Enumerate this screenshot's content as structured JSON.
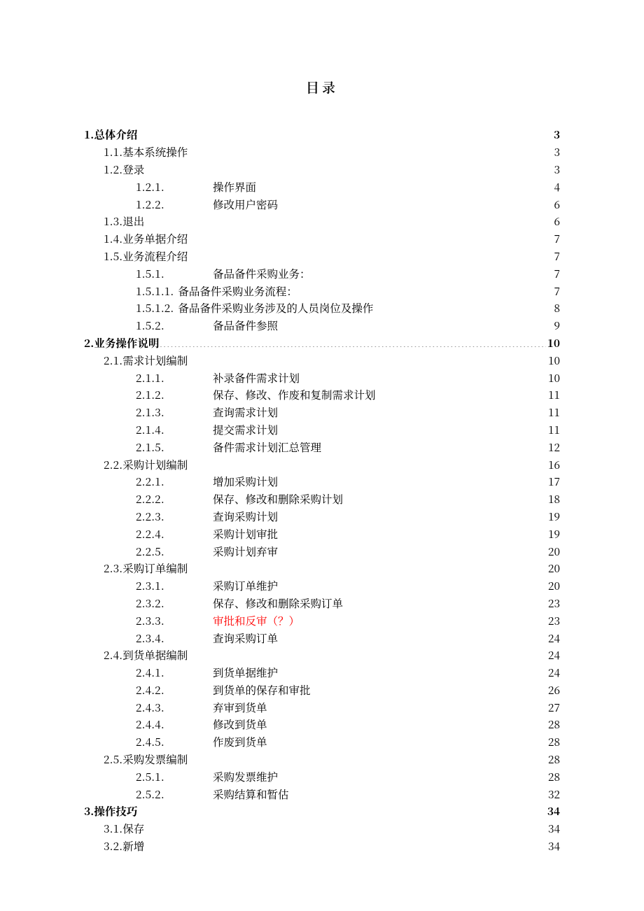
{
  "title": "目录",
  "toc": [
    {
      "level": 1,
      "num": "1.",
      "text": "总体介绍",
      "page": "3",
      "bold": true,
      "color": "",
      "leader": "bold"
    },
    {
      "level": 2,
      "num": "1.1.",
      "text": "基本系统操作",
      "page": "3",
      "bold": false,
      "color": "",
      "leader": "thin"
    },
    {
      "level": 2,
      "num": "1.2.",
      "text": "登录",
      "page": "3",
      "bold": false,
      "color": "",
      "leader": "thin"
    },
    {
      "level": 3,
      "num": "1.2.1.",
      "text": "操作界面",
      "page": "4",
      "bold": false,
      "color": "",
      "leader": "cjk"
    },
    {
      "level": 3,
      "num": "1.2.2.",
      "text": "修改用户密码",
      "page": "6",
      "bold": false,
      "color": "",
      "leader": "cjk"
    },
    {
      "level": 2,
      "num": "1.3.",
      "text": "退出",
      "page": "6",
      "bold": false,
      "color": "",
      "leader": "thin"
    },
    {
      "level": 2,
      "num": "1.4.",
      "text": "业务单据介绍",
      "page": "7",
      "bold": false,
      "color": "",
      "leader": "thin"
    },
    {
      "level": 2,
      "num": "1.5.",
      "text": "业务流程介绍",
      "page": "7",
      "bold": false,
      "color": "",
      "leader": "thin"
    },
    {
      "level": 3,
      "num": "1.5.1.",
      "text": "备品备件采购业务：",
      "page": "7",
      "bold": false,
      "color": "",
      "leader": "cjk"
    },
    {
      "level": 3,
      "num": "1.5.1.1.",
      "text": "备品备件采购业务流程：",
      "page": "7",
      "bold": false,
      "color": "",
      "leader": "cjk",
      "tight": true
    },
    {
      "level": 3,
      "num": "1.5.1.2.",
      "text": "备品备件采购业务涉及的人员岗位及操作",
      "page": "8",
      "bold": false,
      "color": "",
      "leader": "cjk",
      "tight": true
    },
    {
      "level": 3,
      "num": "1.5.2.",
      "text": "备品备件参照",
      "page": "9",
      "bold": false,
      "color": "",
      "leader": "cjk"
    },
    {
      "level": 1,
      "num": "2.",
      "text": "业务操作说明",
      "page": "10",
      "bold": true,
      "color": "",
      "leader": "bold"
    },
    {
      "level": 2,
      "num": "2.1.",
      "text": "需求计划编制",
      "page": "10",
      "bold": false,
      "color": "",
      "leader": "thin"
    },
    {
      "level": 3,
      "num": "2.1.1.",
      "text": "补录备件需求计划",
      "page": "10",
      "bold": false,
      "color": "",
      "leader": "cjk"
    },
    {
      "level": 3,
      "num": "2.1.2.",
      "text": "保存、修改、作废和复制需求计划",
      "page": "11",
      "bold": false,
      "color": "",
      "leader": "cjk"
    },
    {
      "level": 3,
      "num": "2.1.3.",
      "text": "查询需求计划",
      "page": "11",
      "bold": false,
      "color": "",
      "leader": "cjk"
    },
    {
      "level": 3,
      "num": "2.1.4.",
      "text": "提交需求计划",
      "page": "11",
      "bold": false,
      "color": "",
      "leader": "cjk"
    },
    {
      "level": 3,
      "num": "2.1.5.",
      "text": "备件需求计划汇总管理",
      "page": "12",
      "bold": false,
      "color": "",
      "leader": "cjk"
    },
    {
      "level": 2,
      "num": "2.2.",
      "text": "采购计划编制",
      "page": "16",
      "bold": false,
      "color": "",
      "leader": "thin"
    },
    {
      "level": 3,
      "num": "2.2.1.",
      "text": "增加采购计划",
      "page": "17",
      "bold": false,
      "color": "",
      "leader": "cjk"
    },
    {
      "level": 3,
      "num": "2.2.2.",
      "text": "保存、修改和删除采购计划",
      "page": "18",
      "bold": false,
      "color": "",
      "leader": "cjk"
    },
    {
      "level": 3,
      "num": "2.2.3.",
      "text": "查询采购计划",
      "page": "19",
      "bold": false,
      "color": "",
      "leader": "cjk"
    },
    {
      "level": 3,
      "num": "2.2.4.",
      "text": "采购计划审批",
      "page": "19",
      "bold": false,
      "color": "",
      "leader": "cjk"
    },
    {
      "level": 3,
      "num": "2.2.5.",
      "text": "采购计划弃审",
      "page": "20",
      "bold": false,
      "color": "",
      "leader": "cjk"
    },
    {
      "level": 2,
      "num": "2.3.",
      "text": "采购订单编制",
      "page": "20",
      "bold": false,
      "color": "",
      "leader": "thin"
    },
    {
      "level": 3,
      "num": "2.3.1.",
      "text": "采购订单维护",
      "page": "20",
      "bold": false,
      "color": "",
      "leader": "cjk"
    },
    {
      "level": 3,
      "num": "2.3.2.",
      "text": "保存、修改和删除采购订单",
      "page": "23",
      "bold": false,
      "color": "",
      "leader": "cjk"
    },
    {
      "level": 3,
      "num": "2.3.3.",
      "text": "审批和反审（？）",
      "page": "23",
      "bold": false,
      "color": "red",
      "leader": "cjk"
    },
    {
      "level": 3,
      "num": "2.3.4.",
      "text": "查询采购订单",
      "page": "24",
      "bold": false,
      "color": "",
      "leader": "cjk"
    },
    {
      "level": 2,
      "num": "2.4.",
      "text": "到货单据编制",
      "page": "24",
      "bold": false,
      "color": "",
      "leader": "thin"
    },
    {
      "level": 3,
      "num": "2.4.1.",
      "text": "到货单据维护",
      "page": "24",
      "bold": false,
      "color": "",
      "leader": "cjk"
    },
    {
      "level": 3,
      "num": "2.4.2.",
      "text": "到货单的保存和审批",
      "page": "26",
      "bold": false,
      "color": "",
      "leader": "cjk"
    },
    {
      "level": 3,
      "num": "2.4.3.",
      "text": "弃审到货单",
      "page": "27",
      "bold": false,
      "color": "",
      "leader": "cjk"
    },
    {
      "level": 3,
      "num": "2.4.4.",
      "text": "修改到货单",
      "page": "28",
      "bold": false,
      "color": "",
      "leader": "cjk"
    },
    {
      "level": 3,
      "num": "2.4.5.",
      "text": "作废到货单",
      "page": "28",
      "bold": false,
      "color": "",
      "leader": "cjk"
    },
    {
      "level": 2,
      "num": "2.5.",
      "text": "采购发票编制",
      "page": "28",
      "bold": false,
      "color": "",
      "leader": "thin"
    },
    {
      "level": 3,
      "num": "2.5.1.",
      "text": "采购发票维护",
      "page": "28",
      "bold": false,
      "color": "",
      "leader": "cjk"
    },
    {
      "level": 3,
      "num": "2.5.2.",
      "text": "采购结算和暂估",
      "page": "32",
      "bold": false,
      "color": "",
      "leader": "cjk"
    },
    {
      "level": 1,
      "num": "3.",
      "text": "操作技巧",
      "page": "34",
      "bold": true,
      "color": "",
      "leader": "bold"
    },
    {
      "level": 2,
      "num": "3.1.",
      "text": "保存",
      "page": "34",
      "bold": false,
      "color": "",
      "leader": "thin"
    },
    {
      "level": 2,
      "num": "3.2.",
      "text": "新增",
      "page": "34",
      "bold": false,
      "color": "",
      "leader": "thin"
    }
  ]
}
